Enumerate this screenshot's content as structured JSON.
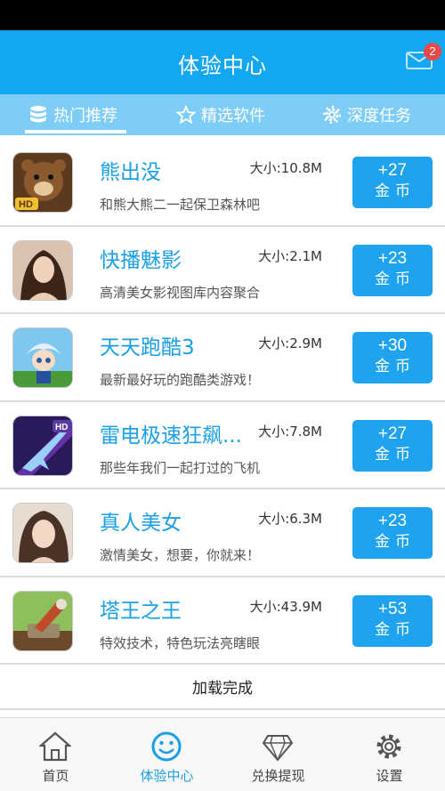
{
  "header": {
    "title": "体验中心",
    "mail_badge": "2"
  },
  "tabs": [
    {
      "label": "热门推荐",
      "icon": "database-icon",
      "active": true
    },
    {
      "label": "精选软件",
      "icon": "star-icon",
      "active": false
    },
    {
      "label": "深度任务",
      "icon": "gear-icon",
      "active": false
    }
  ],
  "apps": [
    {
      "name": "熊出没",
      "size": "大小:10.8M",
      "desc": "和熊大熊二一起保卫森林吧",
      "coins": "+27",
      "unit": "金币",
      "icon": "bear-game-icon"
    },
    {
      "name": "快播魅影",
      "size": "大小:2.1M",
      "desc": "高清美女影视图库内容聚合",
      "coins": "+23",
      "unit": "金币",
      "icon": "photo-app-icon"
    },
    {
      "name": "天天跑酷3",
      "size": "大小:2.9M",
      "desc": "最新最好玩的跑酷类游戏！",
      "coins": "+30",
      "unit": "金币",
      "icon": "runner-game-icon"
    },
    {
      "name": "雷电极速狂飙...",
      "size": "大小:7.8M",
      "desc": "那些年我们一起打过的飞机",
      "coins": "+27",
      "unit": "金币",
      "icon": "jet-game-icon"
    },
    {
      "name": "真人美女",
      "size": "大小:6.3M",
      "desc": "激情美女，想要，你就来！",
      "coins": "+23",
      "unit": "金币",
      "icon": "portrait-app-icon"
    },
    {
      "name": "塔王之王",
      "size": "大小:43.9M",
      "desc": "特效技术，特色玩法亮瞎眼",
      "coins": "+53",
      "unit": "金币",
      "icon": "tower-game-icon"
    }
  ],
  "footer_status": "加载完成",
  "bottom_nav": [
    {
      "label": "首页",
      "icon": "home-icon"
    },
    {
      "label": "体验中心",
      "icon": "smiley-icon"
    },
    {
      "label": "兑换提现",
      "icon": "diamond-icon"
    },
    {
      "label": "设置",
      "icon": "settings-gear-icon"
    }
  ],
  "colors": {
    "primary": "#13a6f1",
    "tab_bar": "#7ecdf6",
    "button": "#1fa3ee",
    "badge": "#e84a4a"
  }
}
